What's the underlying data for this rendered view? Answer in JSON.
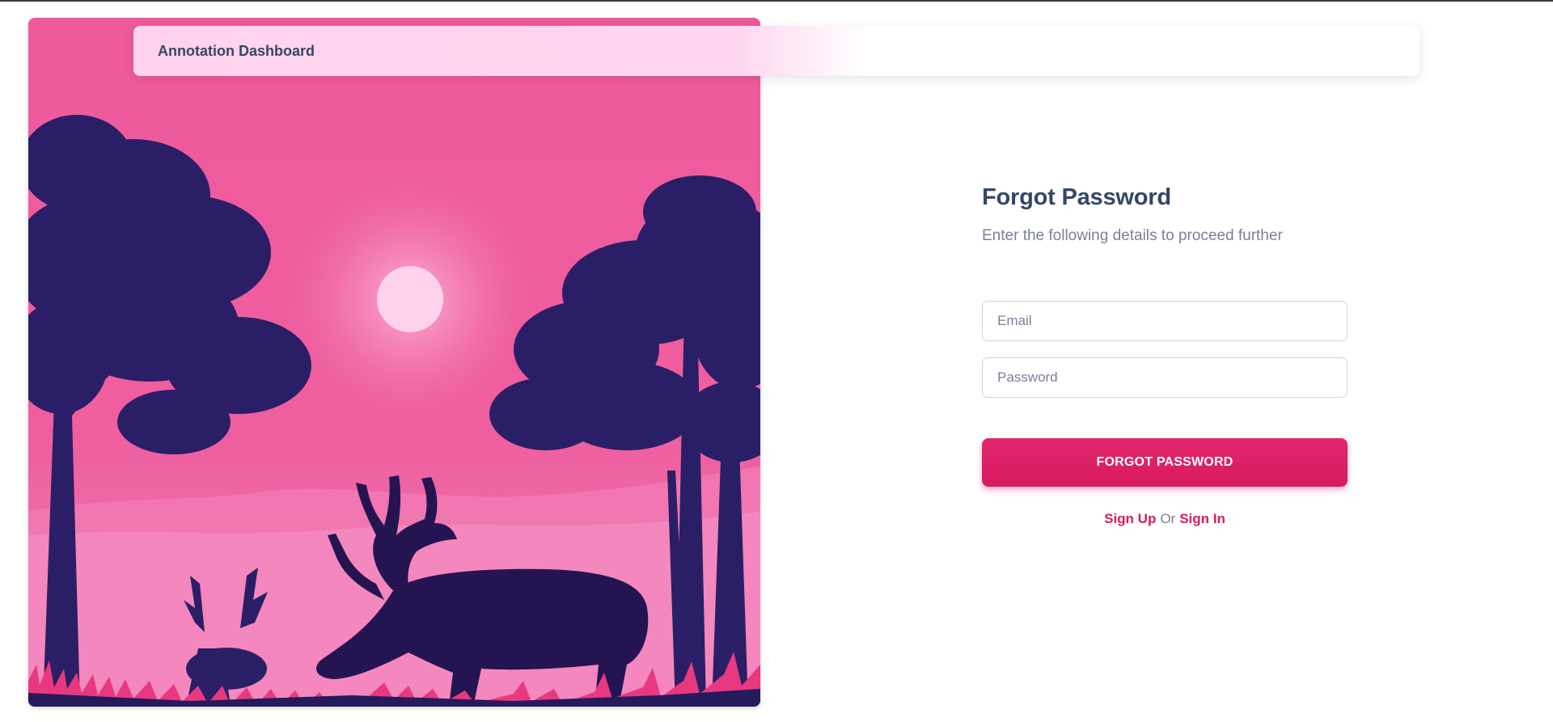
{
  "app": {
    "brand": "Annotation Dashboard"
  },
  "form": {
    "title": "Forgot Password",
    "subtitle": "Enter the following details to proceed further",
    "email": {
      "value": "",
      "placeholder": "Email"
    },
    "password": {
      "value": "",
      "placeholder": "Password"
    },
    "submit_label": "FORGOT PASSWORD"
  },
  "links": {
    "sign_up": "Sign Up",
    "separator": "Or",
    "sign_in": "Sign In"
  },
  "illustration": {
    "description_icon": "deer-forest-sunset-illustration"
  },
  "colors": {
    "accent": "#d81b60",
    "heading": "#344767",
    "muted": "#7b809a",
    "sky": "#ee5a9c",
    "silhouette": "#231a5a"
  }
}
